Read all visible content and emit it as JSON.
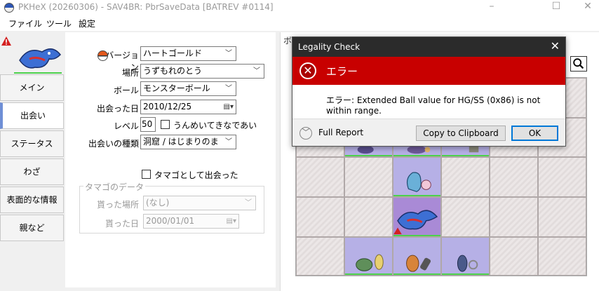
{
  "window": {
    "title": "PKHeX (20260306) - SAV4BR: PbrSaveData [BATREV #0114]",
    "minimize": "–",
    "maximize": "☐",
    "close": "✕"
  },
  "menu": [
    "ファイル",
    "ツール",
    "設定"
  ],
  "sidebar": {
    "tabs": [
      {
        "label": "メイン",
        "active": false
      },
      {
        "label": "出会い",
        "active": true
      },
      {
        "label": "ステータス",
        "active": false
      },
      {
        "label": "わざ",
        "active": false
      },
      {
        "label": "表面的な情報",
        "active": false
      },
      {
        "label": "親など",
        "active": false
      }
    ]
  },
  "met": {
    "version_label": "バージョン",
    "version_value": "ハートゴールド",
    "location_label": "場所",
    "location_value": "うずもれのとう",
    "ball_label": "ボール",
    "ball_value": "モンスターボール",
    "date_label": "出会った日",
    "date_value": "2010/12/25",
    "level_label": "レベル",
    "level_value": "50",
    "fateful_label": "うんめいてきなであい",
    "encounter_label": "出会いの種類",
    "encounter_value": "洞窟 / はじまりのま",
    "egg_met_label": "タマゴとして出会った"
  },
  "egg": {
    "group_title": "タマゴのデータ",
    "location_label": "貰った場所",
    "location_value": "(なし)",
    "date_label": "貰った日",
    "date_value": "2000/01/01"
  },
  "box": {
    "tab_label": "ボ"
  },
  "dialog": {
    "title": "Legality Check",
    "close": "✕",
    "heading": "エラー",
    "message": "エラー: Extended Ball value for HG/SS (0x86) is not within range.",
    "full_report": "Full Report",
    "copy_button": "Copy to Clipboard",
    "ok_button": "OK"
  },
  "colors": {
    "error_band": "#c80000",
    "active_tab_accent": "#6f8fd6",
    "legal_underline": "#4cd14c"
  }
}
